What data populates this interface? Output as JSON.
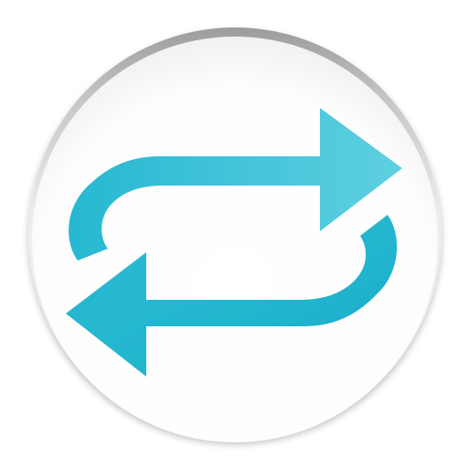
{
  "icon": {
    "name": "repeat-arrows-icon",
    "colors": {
      "accent_light": "#5CCDE0",
      "accent": "#29BAD3",
      "accent_dark": "#12A9C5",
      "badge_white": "#FFFFFF",
      "rim_light": "#D9D9D9",
      "rim_dark": "#9C9C9C",
      "background": "#FFFFFF"
    }
  }
}
